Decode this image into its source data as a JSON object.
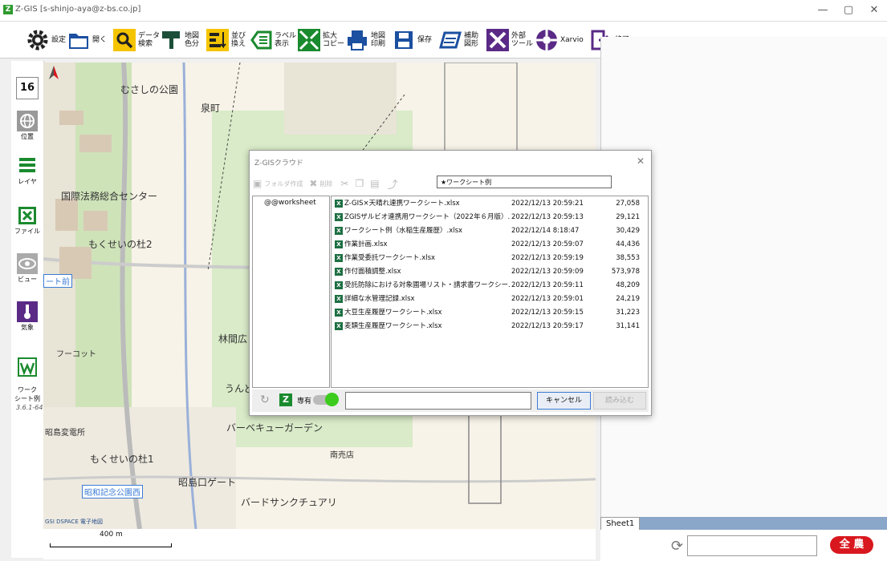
{
  "window": {
    "title": "Z-GIS [s-shinjo-aya@z-bs.co.jp]",
    "app_icon": "Z",
    "controls": [
      "—",
      "▢",
      "✕"
    ]
  },
  "toolbar": {
    "items": [
      {
        "label": "設定",
        "icon": "gear-icon"
      },
      {
        "label": "開く",
        "icon": "folder-icon"
      },
      {
        "label": "データ\n検索",
        "icon": "magnifier-icon"
      },
      {
        "label": "地図\n色分",
        "icon": "paint-roller-icon"
      },
      {
        "label": "並び\n換え",
        "icon": "sort-icon"
      },
      {
        "label": "ラベル\n表示",
        "icon": "label-icon"
      },
      {
        "label": "拡大\nコピー",
        "icon": "expand-icon"
      },
      {
        "label": "地図\n印刷",
        "icon": "printer-icon"
      },
      {
        "label": "保存",
        "icon": "save-icon"
      },
      {
        "label": "補助\n図形",
        "icon": "shape-icon"
      },
      {
        "label": "外部\nツール",
        "icon": "tools-icon"
      },
      {
        "label": "Xarvio",
        "icon": "xarvio-icon"
      },
      {
        "label": "終了",
        "icon": "exit-icon"
      }
    ]
  },
  "sidebar": {
    "zoom_level": "16",
    "items": [
      {
        "label": "位置",
        "icon": "globe-icon"
      },
      {
        "label": "レイヤ",
        "icon": "layers-icon"
      },
      {
        "label": "ファイル",
        "icon": "file-icon"
      },
      {
        "label": "ビュー",
        "icon": "eye-icon"
      },
      {
        "label": "気象",
        "icon": "thermometer-icon"
      },
      {
        "label": "ワーク\nシート例",
        "icon": "worksheet-icon"
      }
    ],
    "version": "3.6.1-64"
  },
  "map": {
    "labels": [
      {
        "text": "むさしの公園"
      },
      {
        "text": "泉町"
      },
      {
        "text": "国際法務総合センター"
      },
      {
        "text": "もくせいの杜2"
      },
      {
        "text": "ート前"
      },
      {
        "text": "林間広"
      },
      {
        "text": "フーコット"
      },
      {
        "text": "うんど"
      },
      {
        "text": "バーベキューガーデン"
      },
      {
        "text": "昭島変電所"
      },
      {
        "text": "もくせいの杜1"
      },
      {
        "text": "南売店"
      },
      {
        "text": "昭和記念公園西"
      },
      {
        "text": "昭島口ゲート"
      },
      {
        "text": "バードサンクチュアリ"
      },
      {
        "text": "電子地図"
      }
    ],
    "copyright": "GSI DSPACE 電子地図",
    "scale_label": "400 m"
  },
  "dialog": {
    "title": "Z-GISクラウド",
    "toolbar": {
      "new_folder": "フォルダ作成",
      "delete": "削除"
    },
    "path": "★ワークシート例",
    "folders": [
      "@@worksheet"
    ],
    "files": [
      {
        "name": "Z-GIS×天晴れ連携ワークシート.xlsx",
        "date": "2022/12/13 20:59:21",
        "size": "27,058"
      },
      {
        "name": "ZGISザルビオ連携用ワークシート（2022年６月版）....",
        "date": "2022/12/13 20:59:13",
        "size": "29,121"
      },
      {
        "name": "ワークシート例（水稲生産履歴）.xlsx",
        "date": "2022/12/14 8:18:47",
        "size": "30,429"
      },
      {
        "name": "作業計画.xlsx",
        "date": "2022/12/13 20:59:07",
        "size": "44,436"
      },
      {
        "name": "作業受委託ワークシート.xlsx",
        "date": "2022/12/13 20:59:19",
        "size": "38,553"
      },
      {
        "name": "作付面積調整.xlsx",
        "date": "2022/12/13 20:59:09",
        "size": "573,978"
      },
      {
        "name": "受託防除における対象圃場リスト・請求書ワークシー...",
        "date": "2022/12/13 20:59:11",
        "size": "48,209"
      },
      {
        "name": "詳細な水管理記録.xlsx",
        "date": "2022/12/13 20:59:01",
        "size": "24,219"
      },
      {
        "name": "大豆生産履歴ワークシート.xlsx",
        "date": "2022/12/13 20:59:15",
        "size": "31,223"
      },
      {
        "name": "麦類生産履歴ワークシート.xlsx",
        "date": "2022/12/13 20:59:17",
        "size": "31,141"
      }
    ],
    "exclusive_label": "専有",
    "cancel_label": "キャンセル",
    "load_label": "読み込む"
  },
  "sheets": {
    "tab": "Sheet1"
  },
  "bottom": {
    "logo": "全 農"
  },
  "colors": {
    "toolbar_green": "#1a8a2e",
    "toolbar_blue": "#1b4fa0",
    "toolbar_purple": "#5a2a86",
    "xl_green": "#1d6f42",
    "zennoh_red": "#d8181e",
    "sheet_bar": "#8aa6c9"
  }
}
